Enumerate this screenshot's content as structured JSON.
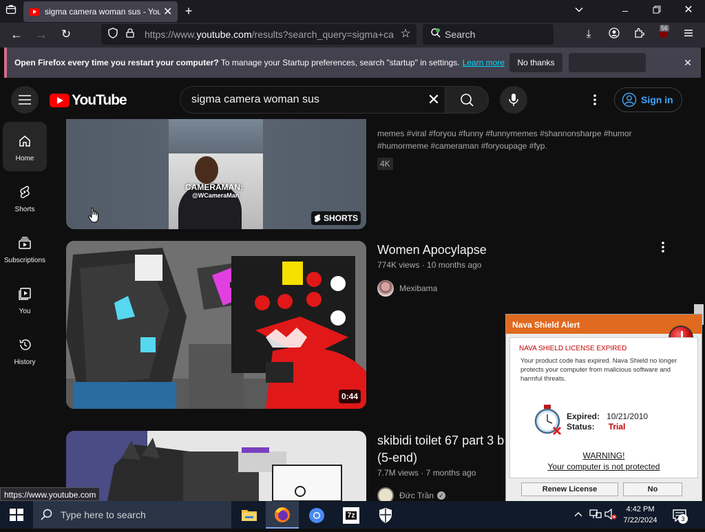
{
  "browser": {
    "tab_title": "sigma camera woman sus - You",
    "url_prefix": "https://www.",
    "url_domain": "youtube.com",
    "url_suffix": "/results?search_query=sigma+ca",
    "search_placeholder": "Search",
    "extension_badge": "56"
  },
  "notification": {
    "bold_text": "Open Firefox every time you restart your computer?",
    "text": " To manage your Startup preferences, search \"startup\" in settings.",
    "link": "Learn more",
    "no_thanks": "No thanks"
  },
  "youtube": {
    "logo_text": "YouTube",
    "search_query": "sigma camera woman sus",
    "sign_in": "Sign in",
    "sidebar": [
      {
        "label": "Home",
        "icon": "home-icon"
      },
      {
        "label": "Shorts",
        "icon": "shorts-icon"
      },
      {
        "label": "Subscriptions",
        "icon": "subscriptions-icon"
      },
      {
        "label": "You",
        "icon": "you-icon"
      },
      {
        "label": "History",
        "icon": "history-icon"
      }
    ],
    "results": [
      {
        "description_line1": "memes #viral #foryou #funny #funnymemes #shannonsharpe #humor",
        "description_line2": "#humormeme #cameraman #foryoupage #fyp.",
        "quality_badge": "4K",
        "thumb_caption": "CAMERAMAN:",
        "thumb_handle": "@WCameraMan",
        "shorts_badge": "SHORTS"
      },
      {
        "title": "Women Apocylapse",
        "meta": "774K views · 10 months ago",
        "channel": "Mexibama",
        "duration": "0:44"
      },
      {
        "title_line1": "skibidi toilet 67 part 3 b",
        "title_line2": "(5-end)",
        "meta": "7.7M views · 7 months ago",
        "channel": "Đức Trần"
      }
    ]
  },
  "popup": {
    "header": "Nava Shield Alert",
    "title": "NAVA SHIELD LICENSE EXPIRED",
    "message": "Your product code has expired. Nava Shield no longer protects your computer from malicious software and harmful threats.",
    "expired_label": "Expired:",
    "expired_value": "10/21/2010",
    "status_label": "Status:",
    "status_value": "Trial",
    "warning": "WARNING!",
    "warning_sub": "Your computer is not protected",
    "renew_button": "Renew License",
    "no_button": "No",
    "accent_color": "#e06a1f"
  },
  "status_url": "https://www.youtube.com",
  "taskbar": {
    "search_placeholder": "Type here to search",
    "time": "4:42 PM",
    "date": "7/22/2024",
    "notification_count": "3"
  }
}
